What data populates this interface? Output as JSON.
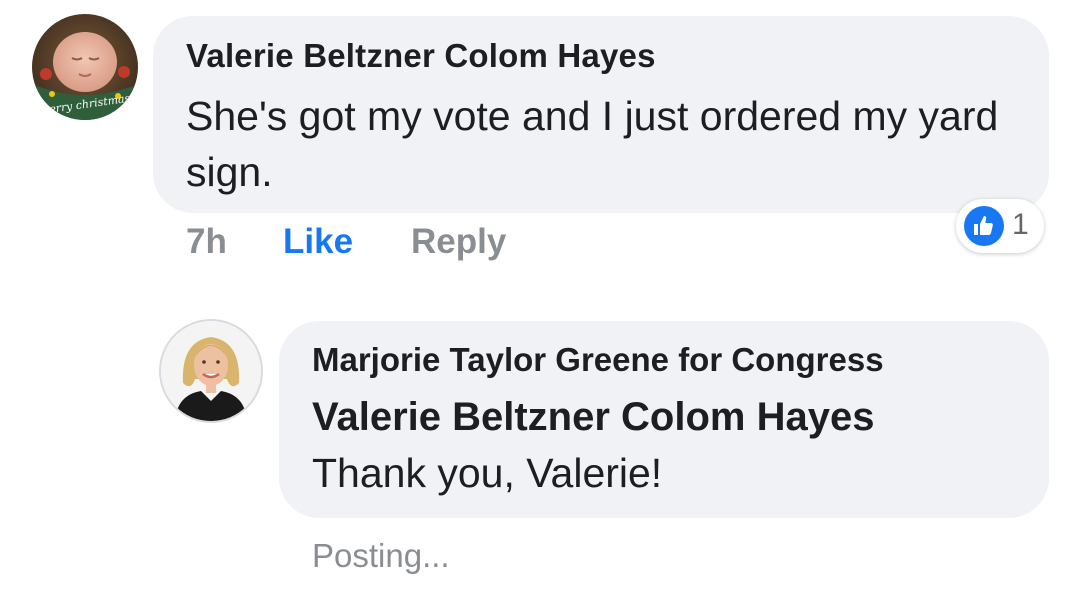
{
  "comment1": {
    "author": "Valerie Beltzner Colom Hayes",
    "text": "She's got my vote and I just ordered my yard sign.",
    "avatar_caption": "merry christmas",
    "time": "7h",
    "like_label": "Like",
    "reply_label": "Reply",
    "reaction_icon": "thumbs-up-icon",
    "reaction_count": "1"
  },
  "comment2": {
    "author": "Marjorie Taylor Greene for Congress",
    "mention": "Valerie Beltzner Colom Hayes",
    "text": "Thank you, Valerie!",
    "status": "Posting..."
  },
  "colors": {
    "bubble": "#f0f2f5",
    "like_blue": "#1877f2",
    "meta_gray": "#8a8d91",
    "text": "#1c1e21"
  }
}
